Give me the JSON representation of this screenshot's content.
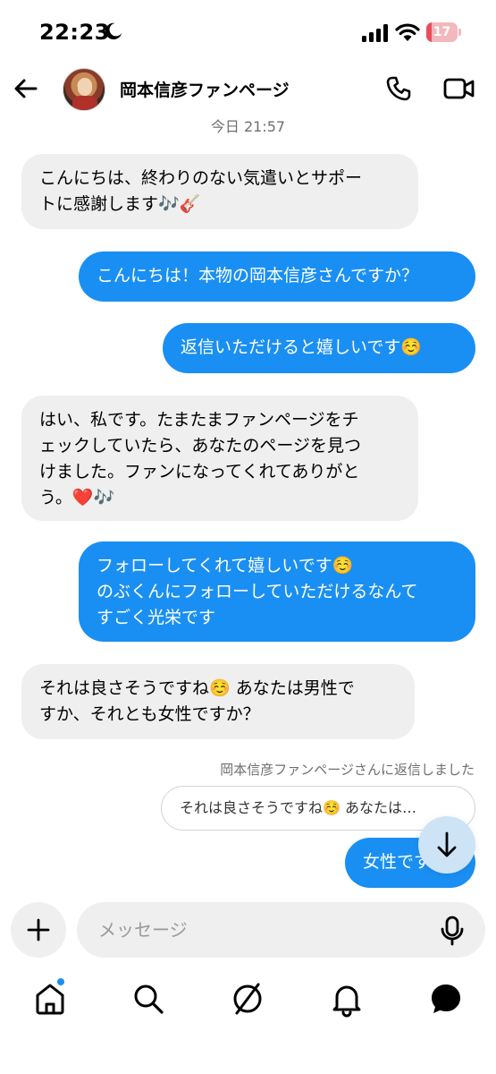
{
  "status_bar": {
    "time": "22:23",
    "battery_level": "17",
    "battery_fraction": 0.17,
    "icons": [
      "moon-icon",
      "signal-icon",
      "wifi-icon",
      "battery-icon"
    ]
  },
  "header": {
    "title": "岡本信彦ファンページ",
    "icons": [
      "back-arrow-icon",
      "avatar",
      "phone-icon",
      "video-camera-icon"
    ]
  },
  "chat": {
    "timestamp": "今日 21:57",
    "messages": [
      {
        "direction": "incoming",
        "text": "こんにちは、終わりのない気遣いとサポー\nトに感謝します🎶🎸"
      },
      {
        "direction": "outgoing",
        "text": "こんにちは！本物の岡本信彦さんですか？"
      },
      {
        "direction": "outgoing",
        "text": "返信いただけると嬉しいです☺️"
      },
      {
        "direction": "incoming",
        "text": "はい、私です。たまたまファンページをチ\nェックしていたら、あなたのページを見つ\nけました。ファンになってくれてありがと\nう。❤️🎶"
      },
      {
        "direction": "outgoing",
        "text": "フォローしてくれて嬉しいです☺️\nのぶくんにフォローしていただけるなんて\nすごく光栄です"
      },
      {
        "direction": "incoming",
        "text": "それは良さそうですね☺️ あなたは男性で\nすか、それとも女性ですか？"
      }
    ],
    "reply_label": "岡本信彦ファンページさんに返信しました",
    "reply_quote": "それは良さそうですね☺️ あなたは…",
    "last_message": "女性です"
  },
  "composer": {
    "placeholder": "メッセージ"
  },
  "nav": {
    "items": [
      "home-icon",
      "search-icon",
      "explore-icon",
      "notifications-icon",
      "messages-icon"
    ]
  },
  "colors": {
    "outgoing_bubble": "#1a8ff3",
    "incoming_bubble": "#efefef",
    "battery_low": "#eb4d58"
  }
}
